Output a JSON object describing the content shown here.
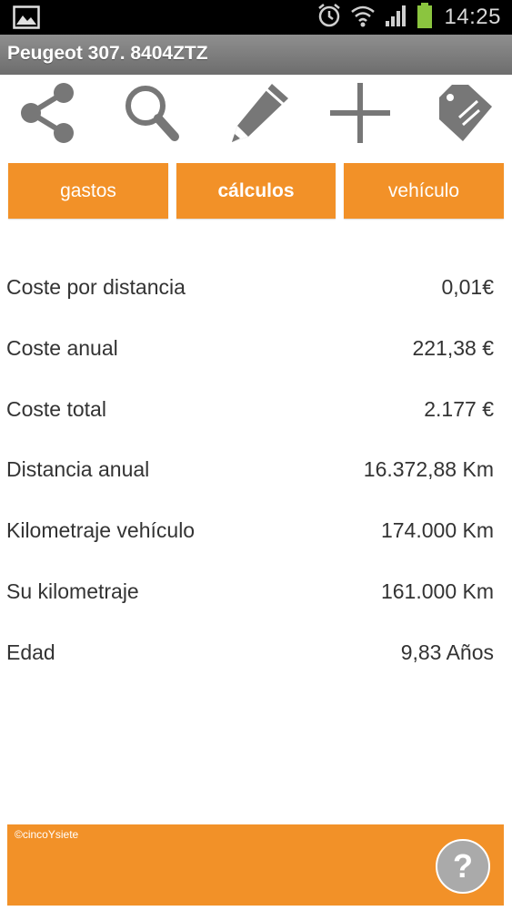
{
  "status_bar": {
    "time": "14:25",
    "icons": [
      "gallery-icon",
      "alarm-icon",
      "wifi-icon",
      "signal-icon",
      "battery-icon"
    ],
    "battery_color": "#8bc53f"
  },
  "app": {
    "title": "Peugeot 307. 8404ZTZ"
  },
  "toolbar": {
    "icons": [
      "share-icon",
      "search-icon",
      "edit-icon",
      "add-icon",
      "tag-icon"
    ]
  },
  "tabs": [
    {
      "label": "gastos",
      "active": false
    },
    {
      "label": "cálculos",
      "active": true
    },
    {
      "label": "vehículo",
      "active": false
    }
  ],
  "rows": [
    {
      "label": "Coste por distancia",
      "value": "0,01€"
    },
    {
      "label": "Coste anual",
      "value": "221,38 €"
    },
    {
      "label": "Coste total",
      "value": "2.177 €"
    },
    {
      "label": "Distancia anual",
      "value": "16.372,88 Km"
    },
    {
      "label": "Kilometraje vehículo",
      "value": "174.000 Km"
    },
    {
      "label": "Su kilometraje",
      "value": "161.000 Km"
    },
    {
      "label": "Edad",
      "value": "9,83 Años"
    }
  ],
  "footer": {
    "credit": "©cincoYsiete",
    "help_label": "?"
  },
  "colors": {
    "accent": "#f29128",
    "icon_gray": "#777777",
    "text": "#333333"
  }
}
